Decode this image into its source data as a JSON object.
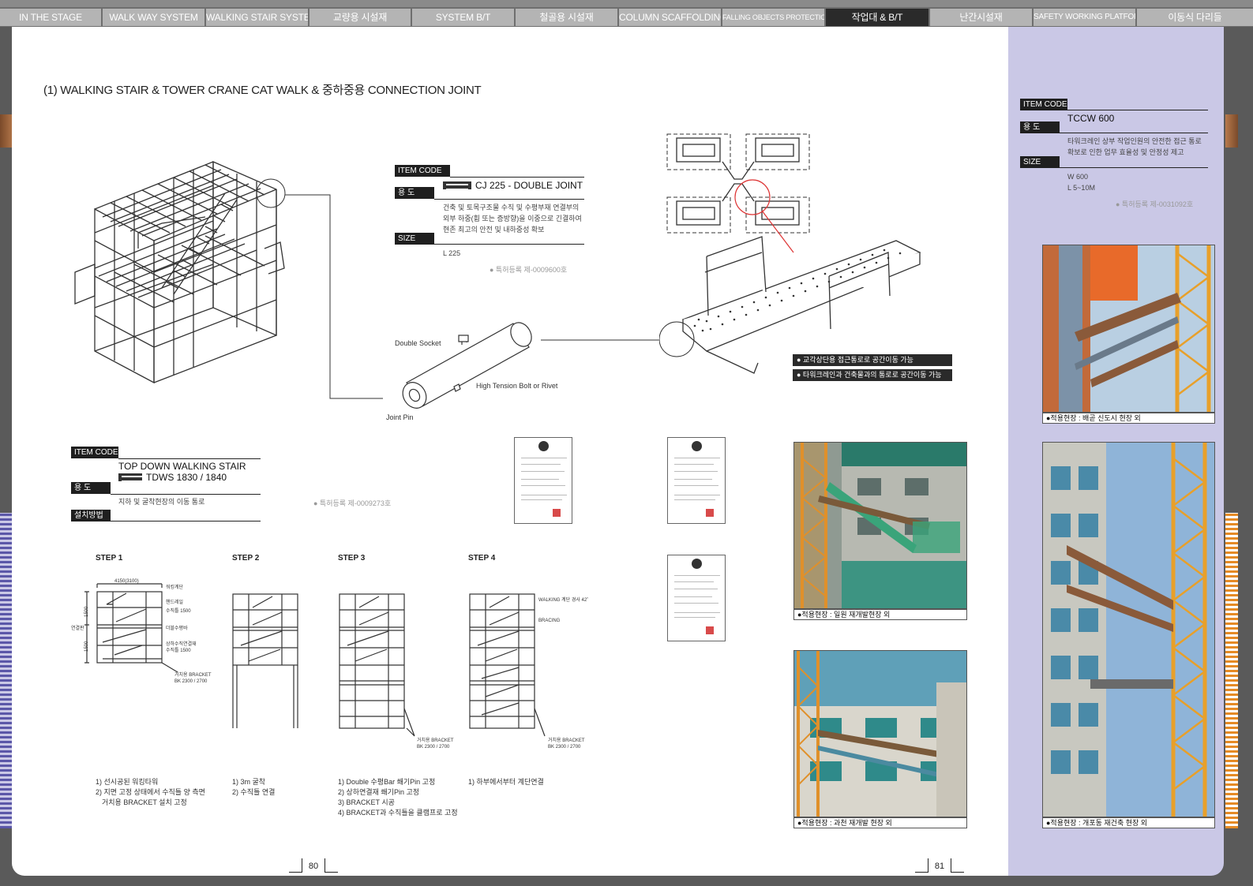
{
  "tabs": [
    {
      "label": "IN THE STAGE"
    },
    {
      "label": "WALK WAY SYSTEM"
    },
    {
      "label": "WALKING STAIR SYSTEM"
    },
    {
      "label": "교량용 시설재"
    },
    {
      "label": "SYSTEM B/T"
    },
    {
      "label": "철골용 시설재"
    },
    {
      "label": "COLUMN SCAFFOLDING"
    },
    {
      "label": "FALLING OBJECTS PROTECTION PLATFORM"
    },
    {
      "label": "작업대 & B/T"
    },
    {
      "label": "난간시설재"
    },
    {
      "label": "SAFETY WORKING PLATFORM"
    },
    {
      "label": "이동식 다리들"
    }
  ],
  "page_title": "(1) WALKING STAIR & TOWER CRANE CAT WALK & 중하중용 CONNECTION JOINT",
  "labels": {
    "item_code": "ITEM CODE",
    "usage": "용 도",
    "size": "SIZE",
    "install": "설치방법"
  },
  "double_joint": {
    "code": "CJ 225 - DOUBLE JOINT",
    "usage": [
      "건축 및 토목구조물 수직 및 수평부재 연결부의",
      "외부 하중(휨 또는 증방향)을 이중으로 긴결하여",
      "현존 최고의 안전 및 내하중성 확보"
    ],
    "size": "L 225",
    "patent": "● 특허등록  제-0009600호",
    "parts": {
      "socket": "Double Socket",
      "bolt": "High Tension Bolt or Rivet",
      "pin": "Joint Pin"
    }
  },
  "catwalk_features": [
    "● 교각상단용 접근통로로 공간이동 가능",
    "● 타워크레인과 건축물과의 통로로 공간이동 가능"
  ],
  "walking_stair": {
    "name": "TOP DOWN WALKING STAIR",
    "code": "TDWS 1830 / 1840",
    "usage": "지하 및 굴착현장의 이동 통로",
    "patent": "● 특허등록  제-0009273호"
  },
  "steps": [
    {
      "title": "STEP 1",
      "notes": [
        "1) 선시공된 워킹타워",
        "2) 지면 고정 상태에서 수직틀 양 측면",
        "   거치용 BRACKET 설치 고정"
      ]
    },
    {
      "title": "STEP 2",
      "notes": [
        "1) 3m 굴착",
        "2) 수직틀 연결"
      ]
    },
    {
      "title": "STEP 3",
      "notes": [
        "1) Double 수평Bar 쐐기Pin 고정",
        "2) 상하연결재 쐐기Pin 고정",
        "3) BRACKET 시공",
        "4) BRACKET과 수직틀을 클램프로 고정"
      ]
    },
    {
      "title": "STEP 4",
      "notes": [
        "1) 하부에서부터 계단연결"
      ]
    }
  ],
  "step1_dims": {
    "width": "4150(3100)",
    "h1": "1500",
    "h2": "1500",
    "side": "연결판"
  },
  "step1_callouts": [
    "워킹계단",
    "핸드레일",
    "수직틀 1500",
    "더블수평바",
    "상하수직연결재",
    "수직틀 1500",
    "거치용 BRACKET",
    "BK 2300 / 2700"
  ],
  "step3_callouts": [
    "거치용 BRACKET",
    "BK 2300 / 2700"
  ],
  "step4_callouts": [
    "WALKING 계단 경사 42˚",
    "BRACING",
    "거치용 BRACKET",
    "BK 2300 / 2700"
  ],
  "tccw": {
    "code": "TCCW 600",
    "usage": [
      "타워크레인 상부 작업인원의 안전한 접근 통로",
      "확보로 인한 업무 효율성 및 안정성 제고"
    ],
    "size": [
      "W 600",
      "L 5~10M"
    ],
    "patent": "● 특허등록  제-0031092호"
  },
  "photo_captions": {
    "p1": "●적용현장 : 일원 재개발현장 외",
    "p2": "●적용현장 : 과천 재개발 현장 외",
    "p3": "●적용현장 : 배곧 신도시 현장 외",
    "p4": "●적용현장 : 개포동 재건축 현장 외"
  },
  "page_numbers": {
    "left": "80",
    "right": "81"
  },
  "colors": {
    "accent_purple": "#cac8e6",
    "tab_active": "#2a2a2a",
    "crane_orange": "#e0902a"
  }
}
